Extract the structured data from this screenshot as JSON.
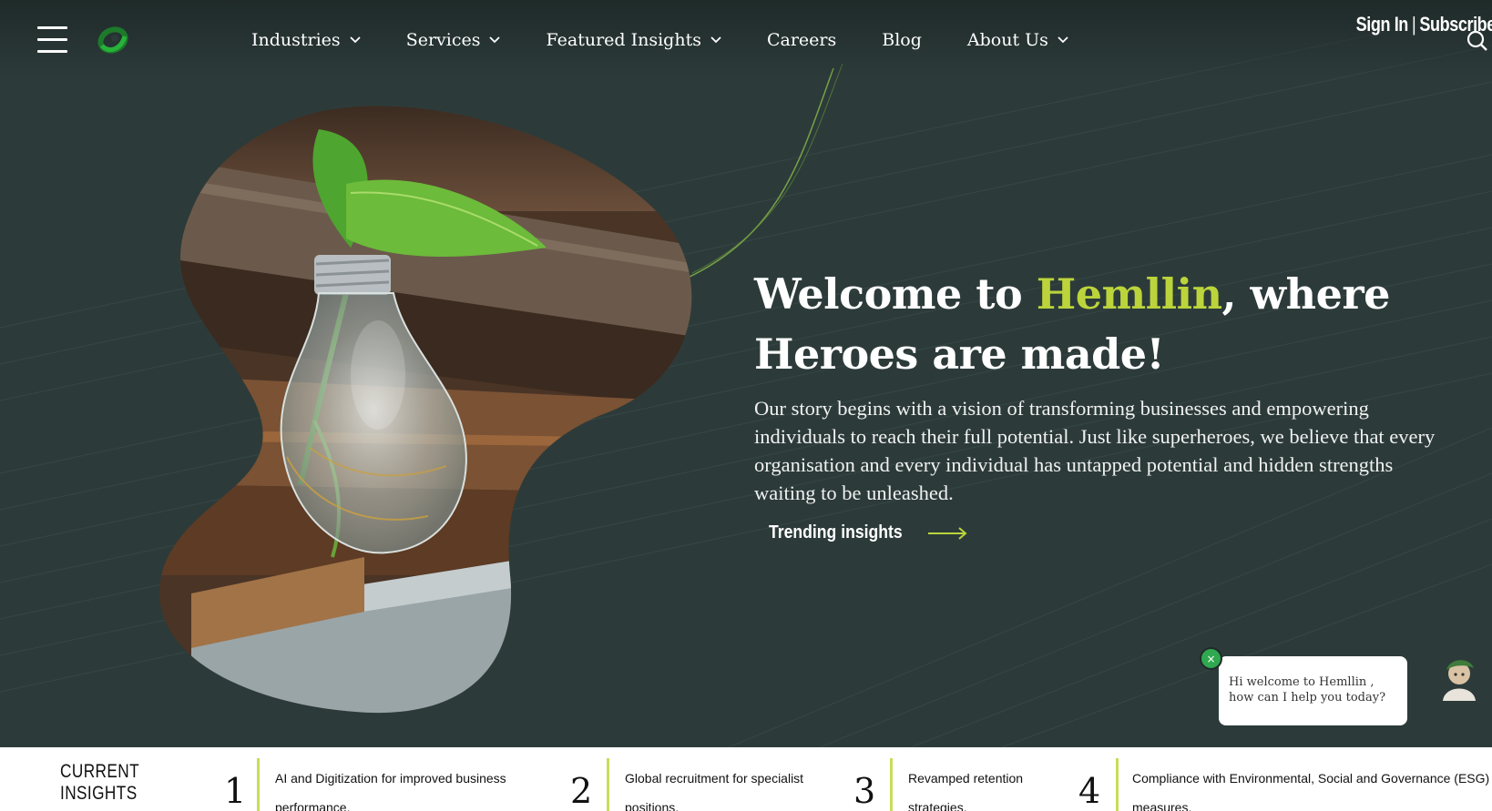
{
  "nav": {
    "items": [
      {
        "label": "Industries",
        "dropdown": true
      },
      {
        "label": "Services",
        "dropdown": true
      },
      {
        "label": "Featured Insights",
        "dropdown": true
      },
      {
        "label": "Careers",
        "dropdown": false
      },
      {
        "label": "Blog",
        "dropdown": false
      },
      {
        "label": "About Us",
        "dropdown": true
      }
    ],
    "sign_in": "Sign In",
    "separator": "|",
    "subscribe": "Subscribe"
  },
  "hero": {
    "title_prefix": "Welcome to ",
    "title_brand": "Hemllin",
    "title_suffix": ", where Heroes are made!",
    "body": "Our story begins with a vision of transforming businesses and empowering individuals to reach their full potential. Just like superheroes, we believe that every organisation and every individual has untapped potential and hidden strengths waiting to be unleashed.",
    "cta_label": "Trending insights"
  },
  "chat": {
    "close_glyph": "×",
    "message_line1": "Hi welcome to Hemllin ,",
    "message_line2": "how can I help you today?"
  },
  "insights": {
    "label_line1": "CURRENT",
    "label_line2": "INSIGHTS",
    "items": [
      {
        "num": "1",
        "line1": "AI and Digitization for improved business",
        "line2": "performance."
      },
      {
        "num": "2",
        "line1": "Global recruitment for specialist",
        "line2": "positions."
      },
      {
        "num": "3",
        "line1": "Revamped retention",
        "line2": "strategies."
      },
      {
        "num": "4",
        "line1": "Compliance with Environmental, Social and Governance (ESG)",
        "line2": "measures."
      }
    ]
  },
  "colors": {
    "background": "#2c3b3a",
    "accent": "#bcd43b",
    "chat_close": "#2fa84f",
    "insight_divider": "#c9dc5a"
  },
  "icons": {
    "menu": "hamburger-icon",
    "logo": "hemllin-logo",
    "search": "search-icon",
    "dropdown": "chevron-down-icon",
    "cta": "arrow-right-icon",
    "chat_close": "close-icon",
    "chat_avatar": "chatbot-avatar"
  }
}
